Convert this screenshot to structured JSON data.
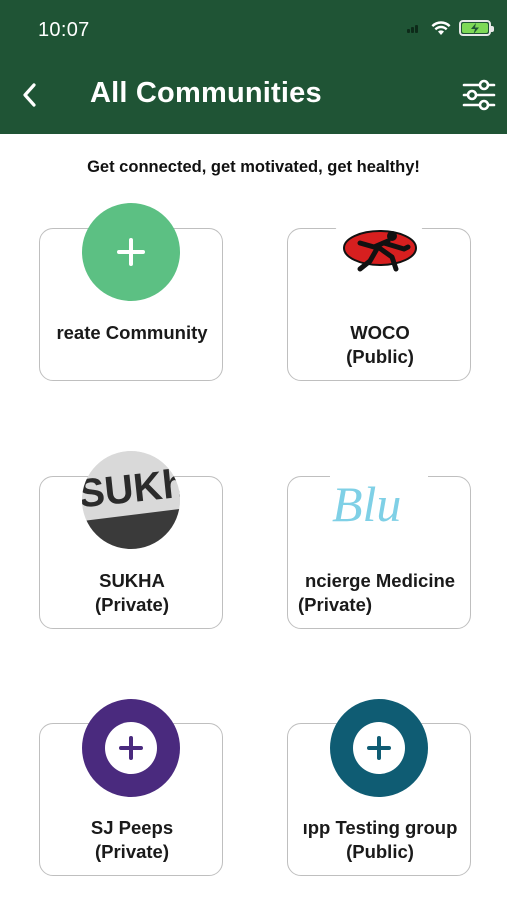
{
  "status_bar": {
    "time": "10:07"
  },
  "header": {
    "title": "All Communities",
    "back_icon": "chevron-left-icon",
    "filter_icon": "sliders-icon"
  },
  "tagline": "Get connected, get motivated, get healthy!",
  "colors": {
    "header_bg": "#1f5435",
    "create_green": "#5cc083",
    "purple": "#4a2a7e",
    "teal": "#0f5c73"
  },
  "communities": [
    {
      "name": "reate Community",
      "privacy": ""
    },
    {
      "name": "WOCO",
      "privacy": "(Public)"
    },
    {
      "name": "SUKHA",
      "privacy": "(Private)"
    },
    {
      "name": "ncierge Medicine",
      "privacy": "(Private)"
    },
    {
      "name": "SJ Peeps",
      "privacy": "(Private)"
    },
    {
      "name": "ıpp Testing group",
      "privacy": "(Public)"
    }
  ],
  "logo_text": {
    "sukha": "SUKha",
    "blue": "Blu"
  }
}
